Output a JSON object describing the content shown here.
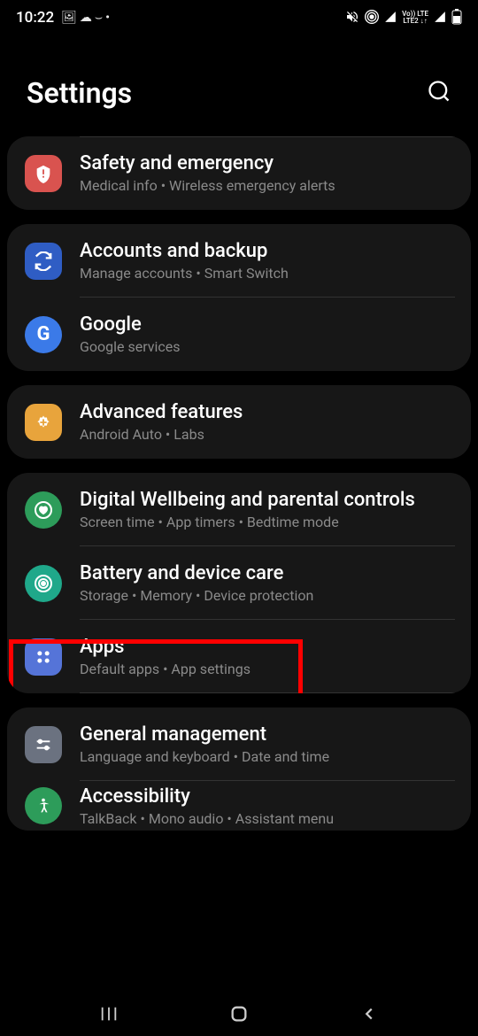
{
  "statusBar": {
    "time": "10:22",
    "lteLabel1": "Vo)) LTE",
    "lteLabel2": "LTE2 ↓↑"
  },
  "header": {
    "title": "Settings"
  },
  "groups": [
    {
      "items": [
        {
          "icon": "safety",
          "title": "Safety and emergency",
          "subtitle": "Medical info  •  Wireless emergency alerts",
          "topDivider": true
        }
      ]
    },
    {
      "items": [
        {
          "icon": "accounts",
          "title": "Accounts and backup",
          "subtitle": "Manage accounts  •  Smart Switch"
        },
        {
          "icon": "google",
          "title": "Google",
          "subtitle": "Google services"
        }
      ]
    },
    {
      "items": [
        {
          "icon": "advanced",
          "title": "Advanced features",
          "subtitle": "Android Auto  •  Labs"
        }
      ]
    },
    {
      "items": [
        {
          "icon": "wellbeing",
          "title": "Digital Wellbeing and parental controls",
          "subtitle": "Screen time  •  App timers  •  Bedtime mode"
        },
        {
          "icon": "battery",
          "title": "Battery and device care",
          "subtitle": "Storage  •  Memory  •  Device protection"
        },
        {
          "icon": "apps",
          "title": "Apps",
          "subtitle": "Default apps  •  App settings",
          "highlighted": true
        }
      ]
    },
    {
      "items": [
        {
          "icon": "general",
          "title": "General management",
          "subtitle": "Language and keyboard  •  Date and time"
        },
        {
          "icon": "accessibility",
          "title": "Accessibility",
          "subtitle": "TalkBack  •  Mono audio  •  Assistant menu",
          "cutoff": true
        }
      ]
    }
  ]
}
